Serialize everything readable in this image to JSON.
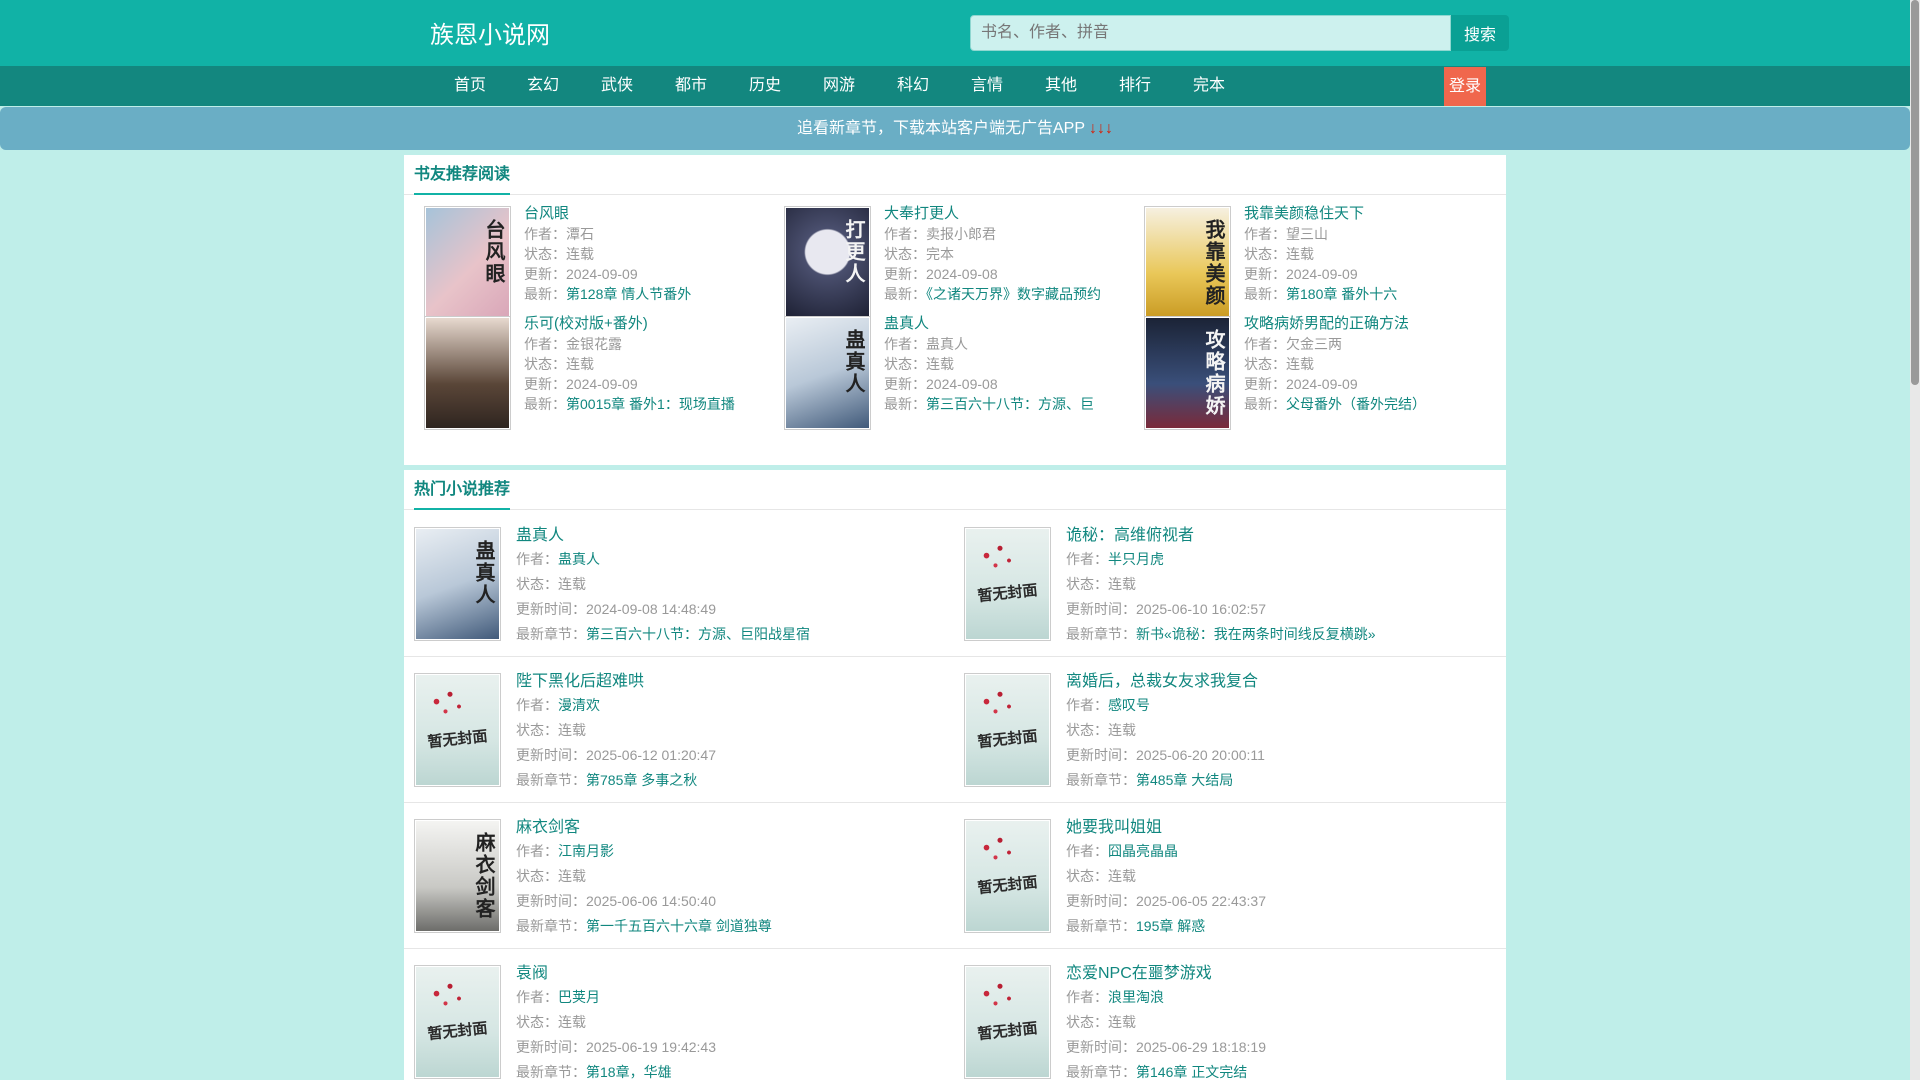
{
  "header": {
    "logo": "族恩小说网",
    "search_placeholder": "书名、作者、拼音",
    "search_button": "搜索"
  },
  "nav": {
    "items": [
      "首页",
      "玄幻",
      "武侠",
      "都市",
      "历史",
      "网游",
      "科幻",
      "言情",
      "其他",
      "排行",
      "完本"
    ],
    "login": "登录"
  },
  "notice": {
    "text": "追看新章节，下载本站客户端无广告APP",
    "arrows": "↓↓↓"
  },
  "recommend": {
    "title": "书友推荐阅读",
    "labels": {
      "author": "作者：",
      "status": "状态：",
      "update": "更新：",
      "latest": "最新："
    },
    "books": [
      {
        "title": "台风眼",
        "cover_text": "台风眼",
        "author": "潭石",
        "status": "连载",
        "update": "2024-09-09",
        "latest": "第128章 情人节番外"
      },
      {
        "title": "大奉打更人",
        "cover_text": "打更人",
        "author": "卖报小郎君",
        "status": "完本",
        "update": "2024-09-08",
        "latest": "《之诸天万界》数字藏品预约"
      },
      {
        "title": "我靠美颜稳住天下",
        "cover_text": "我靠美颜",
        "author": "望三山",
        "status": "连载",
        "update": "2024-09-09",
        "latest": "第180章 番外十六"
      },
      {
        "title": "乐可(校对版+番外)",
        "cover_text": "",
        "author": "金银花露",
        "status": "连载",
        "update": "2024-09-09",
        "latest": "第0015章 番外1：现场直播"
      },
      {
        "title": "蛊真人",
        "cover_text": "蛊真人",
        "author": "蛊真人",
        "status": "连载",
        "update": "2024-09-08",
        "latest": "第三百六十八节：方源、巨"
      },
      {
        "title": "攻略病娇男配的正确方法",
        "cover_text": "攻略病娇",
        "author": "欠金三两",
        "status": "连载",
        "update": "2024-09-09",
        "latest": "父母番外（番外完结）"
      }
    ]
  },
  "hot": {
    "title": "热门小说推荐",
    "labels": {
      "author": "作者：",
      "status": "状态：",
      "update": "更新时间：",
      "latest": "最新章节："
    },
    "default_cover_text": "暂无封面",
    "books": [
      {
        "title": "蛊真人",
        "cover_text": "蛊真人",
        "author": "蛊真人",
        "status": "连载",
        "update": "2024-09-08 14:48:49",
        "latest": "第三百六十八节：方源、巨阳战星宿"
      },
      {
        "title": "诡秘：高维俯视者",
        "cover_text": "",
        "author": "半只月虎",
        "status": "连载",
        "update": "2025-06-10 16:02:57",
        "latest": "新书«诡秘：我在两条时间线反复横跳»"
      },
      {
        "title": "陛下黑化后超难哄",
        "cover_text": "",
        "author": "漫清欢",
        "status": "连载",
        "update": "2025-06-12 01:20:47",
        "latest": "第785章 多事之秋"
      },
      {
        "title": "离婚后，总裁女友求我复合",
        "cover_text": "",
        "author": "感叹号",
        "status": "连载",
        "update": "2025-06-20 20:00:11",
        "latest": "第485章 大结局"
      },
      {
        "title": "麻衣剑客",
        "cover_text": "麻衣剑客",
        "author": "江南月影",
        "status": "连载",
        "update": "2025-06-06 14:50:40",
        "latest": "第一千五百六十六章 剑道独尊"
      },
      {
        "title": "她要我叫姐姐",
        "cover_text": "",
        "author": "囧晶亮晶晶",
        "status": "连载",
        "update": "2025-06-05 22:43:37",
        "latest": "195章 解惑"
      },
      {
        "title": "袁阀",
        "cover_text": "",
        "author": "巴荚月",
        "status": "连载",
        "update": "2025-06-19 19:42:43",
        "latest": "第18章，华雄"
      },
      {
        "title": "恋爱NPC在噩梦游戏",
        "cover_text": "",
        "author": "浪里淘浪",
        "status": "连载",
        "update": "2025-06-29 18:18:19",
        "latest": "第146章 正文完结"
      }
    ]
  },
  "colors": {
    "accent": "#11b2a6",
    "nav": "#13877f",
    "login": "#f0674d",
    "link": "#11877f"
  }
}
